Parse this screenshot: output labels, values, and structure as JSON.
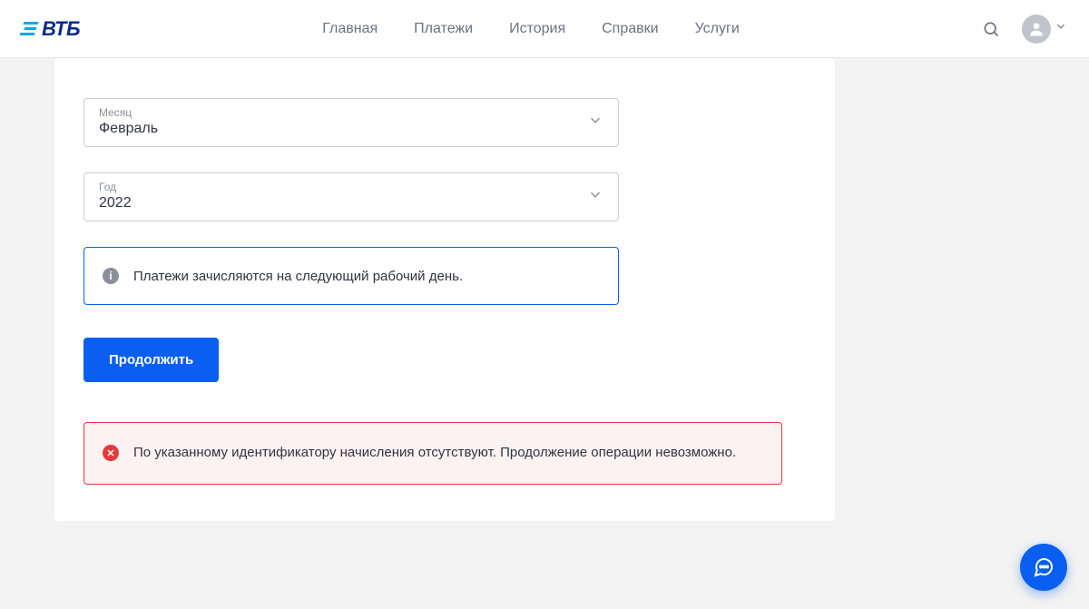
{
  "header": {
    "brand": "ВТБ",
    "nav": {
      "home": "Главная",
      "payments": "Платежи",
      "history": "История",
      "references": "Справки",
      "services": "Услуги"
    }
  },
  "form": {
    "month": {
      "label": "Месяц",
      "value": "Февраль"
    },
    "year": {
      "label": "Год",
      "value": "2022"
    },
    "info_text": "Платежи зачисляются на следующий рабочий день.",
    "continue_label": "Продолжить",
    "error_text": "По указанному идентификатору начисления отсутствуют. Продолжение операции невозможно."
  }
}
